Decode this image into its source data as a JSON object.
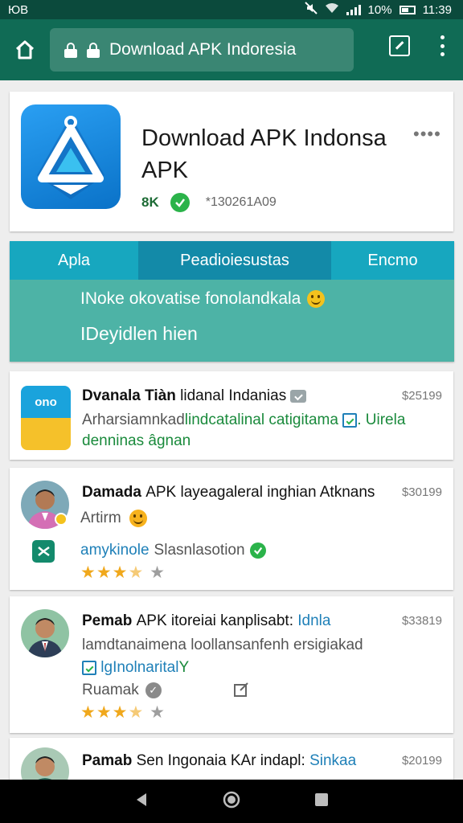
{
  "status_bar": {
    "left": "ЮВ",
    "battery": "10%",
    "time": "11:39"
  },
  "toolbar": {
    "url": "Download APK Indoresia"
  },
  "hero": {
    "title": "Download APK Indonsa APK",
    "size": "8K",
    "code": "*130261A09"
  },
  "tabs": [
    {
      "label": "Apla"
    },
    {
      "label": "Peadioiesustas"
    },
    {
      "label": "Encmo"
    }
  ],
  "panel": {
    "line1": "INoke okovatise fonolandkala",
    "line2": "IDeyidlen hien"
  },
  "items": [
    {
      "title_bold": "Dvanala Tiàn",
      "title_rest": "lidanal Indanias",
      "price": "$25199",
      "icon_text": "ono",
      "desc_dark": "Arharsiamnkad",
      "desc_green": "lindcatalinal catigitama",
      "desc_tail": ". Uirela",
      "desc2": "denninas âgnan"
    },
    {
      "title_bold": "Damada",
      "title_rest": "APK layeagaleral inghian Atknans",
      "price": "$30199",
      "sub": "Artirm",
      "dev": "amykinole",
      "dev_rest": "Slasnlasotion",
      "rating": 3.5
    },
    {
      "title_bold": "Pemab",
      "title_rest": "APK itoreiai kanplisabt:",
      "title_blue": "Idnla",
      "price": "$33819",
      "line2": "lamdtanaimena loollansanfenh ersigiakad",
      "line3": "lgInolnarital",
      "line3_tail": "Y",
      "dev": "Ruamak",
      "rating": 3.5
    },
    {
      "title_bold": "Pamab",
      "title_rest": "Sen Ingonaia KAr indapl:",
      "title_blue": "Sinkaa",
      "price": "$20199"
    }
  ],
  "colors": {
    "status_bar": "#0b4a3c",
    "toolbar": "#106b55",
    "tabs": "#17a7bf",
    "panel": "#4db3a6",
    "accent_green": "#1a8a3c",
    "star": "#f0a81c"
  },
  "icons": [
    "home-icon",
    "lock-icon",
    "tab-switcher-icon",
    "more-vert-icon",
    "verified-icon",
    "back-icon",
    "home-nav-icon",
    "recents-icon"
  ]
}
